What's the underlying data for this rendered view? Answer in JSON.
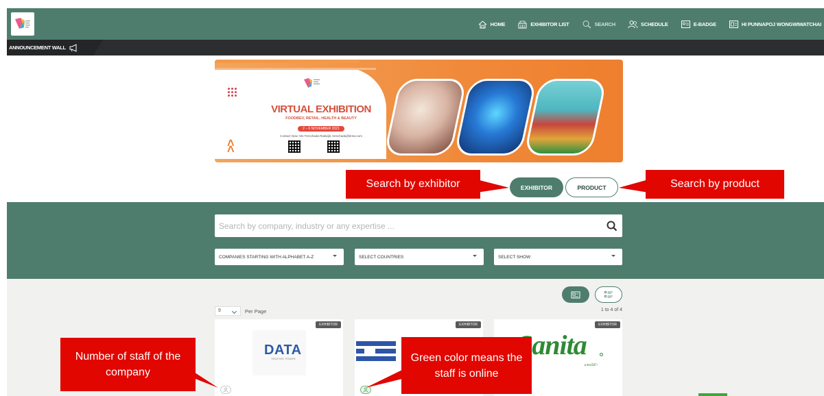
{
  "nav": {
    "items": [
      {
        "label": "HOME",
        "icon": "home-icon"
      },
      {
        "label": "EXHIBITOR LIST",
        "icon": "building-icon"
      },
      {
        "label": "SEARCH",
        "icon": "search-icon"
      },
      {
        "label": "SCHEDULE",
        "icon": "users-icon"
      },
      {
        "label": "E-BADGE",
        "icon": "badge-icon"
      },
      {
        "label": "HI PUNNAPOJ WONGWIWATCHAI",
        "icon": "profile-card-icon"
      }
    ],
    "accent": "#4e7d6e"
  },
  "announcement": {
    "label": "ANNOUNCEMENT WALL",
    "icon": "megaphone-icon"
  },
  "banner": {
    "title": "VIRTUAL EXHIBITION",
    "subtitle": "FOODBEV, RETAIL, HEALTH & BEAUTY",
    "date": "2 – 6 NOVEMBER 2021",
    "contact": "Contact Now: Ms.Trenchada Radwijit, trenchada@tirew.com"
  },
  "toggle": {
    "exhibitor": "EXHIBITOR",
    "product": "PRODUCT"
  },
  "search": {
    "placeholder": "Search by company, industry or any expertise ..."
  },
  "filters": {
    "alphabet": "COMPANIES STARTING WITH ALPHABET A-Z",
    "countries": "SELECT COUNTRIES",
    "show": "SELECT SHOW"
  },
  "results": {
    "per_page_value": "9",
    "per_page_label": "Per Page",
    "count": "1 to 4 of 4"
  },
  "cards": [
    {
      "badge": "EXHIBITOR",
      "logo_text": "DATA",
      "logo_sub": "TRUSTED POWER"
    },
    {
      "badge": "EXHIBITOR"
    },
    {
      "badge": "EXHIBITOR",
      "logo_text": "Sanita",
      "logo_sub": "แซนนิต้า"
    }
  ],
  "callouts": {
    "exhibitor": "Search by exhibitor",
    "product": "Search by product",
    "staff": "Number of staff of the company",
    "online": "Green color means the staff is online"
  }
}
